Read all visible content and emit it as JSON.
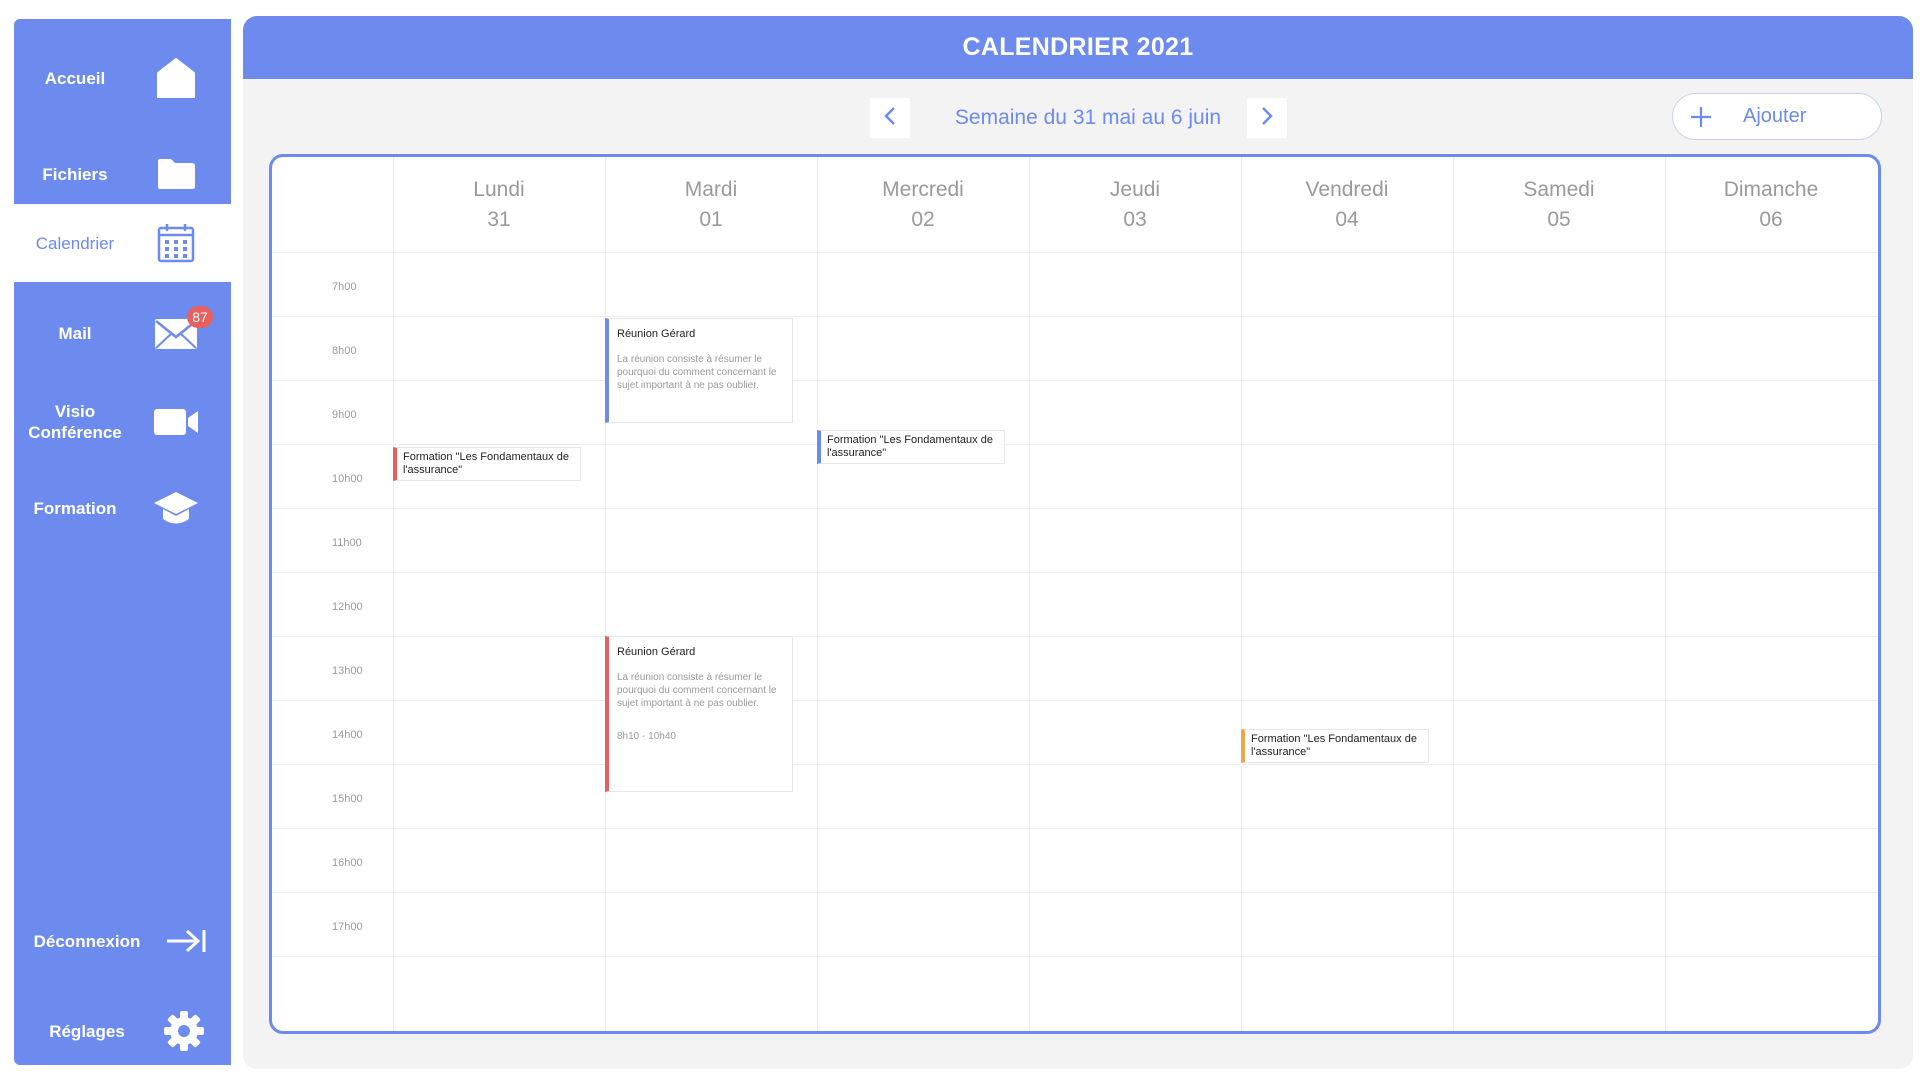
{
  "sidebar": {
    "items": [
      {
        "label": "Accueil",
        "icon": "home-icon"
      },
      {
        "label": "Fichiers",
        "icon": "folder-icon"
      },
      {
        "label": "Calendrier",
        "icon": "calendar-icon",
        "active": true
      },
      {
        "label": "Mail",
        "icon": "mail-icon",
        "badge": "87"
      },
      {
        "label": "Visio Conférence",
        "icon": "video-camera-icon"
      },
      {
        "label": "Formation",
        "icon": "graduation-cap-icon"
      }
    ],
    "bottom_items": [
      {
        "label": "Déconnexion",
        "icon": "logout-icon"
      },
      {
        "label": "Réglages",
        "icon": "gear-icon"
      }
    ]
  },
  "header": {
    "title": "CALENDRIER 2021"
  },
  "week_nav": {
    "label": "Semaine du 31 mai au 6 juin",
    "prev_icon": "chevron-left-icon",
    "next_icon": "chevron-right-icon"
  },
  "add_button": {
    "label": "Ajouter",
    "icon": "plus-icon"
  },
  "days": [
    {
      "name": "Lundi",
      "date": "31"
    },
    {
      "name": "Mardi",
      "date": "01"
    },
    {
      "name": "Mercredi",
      "date": "02"
    },
    {
      "name": "Jeudi",
      "date": "03"
    },
    {
      "name": "Vendredi",
      "date": "04"
    },
    {
      "name": "Samedi",
      "date": "05"
    },
    {
      "name": "Dimanche",
      "date": "06"
    }
  ],
  "hours": [
    "7h00",
    "8h00",
    "9h00",
    "10h00",
    "11h00",
    "12h00",
    "13h00",
    "14h00",
    "15h00",
    "16h00",
    "17h00"
  ],
  "events": [
    {
      "title": "Réunion Gérard",
      "description": "La réunion consiste à résumer le pourquoi du comment concernant le sujet important à ne pas oublier.",
      "time": "",
      "color": "#6d8aee"
    },
    {
      "title": "Formation \"Les Fondamentaux de l'assurance\"",
      "description": "",
      "time": "",
      "color": "#e8605e"
    },
    {
      "title": "Formation \"Les Fondamentaux de l'assurance\"",
      "description": "",
      "time": "",
      "color": "#6d8aee"
    },
    {
      "title": "Réunion Gérard",
      "description": "La réunion consiste à résumer le pourquoi du comment concernant le sujet important à ne pas oublier.",
      "time": "8h10 - 10h40",
      "color": "#e8605e"
    },
    {
      "title": "Formation \"Les Fondamentaux de l'assurance\"",
      "description": "",
      "time": "",
      "color": "#f0a54a"
    }
  ],
  "colors": {
    "accent": "#6d8aee",
    "red": "#e8605e",
    "orange": "#f0a54a",
    "background": "#f3f3f3"
  }
}
